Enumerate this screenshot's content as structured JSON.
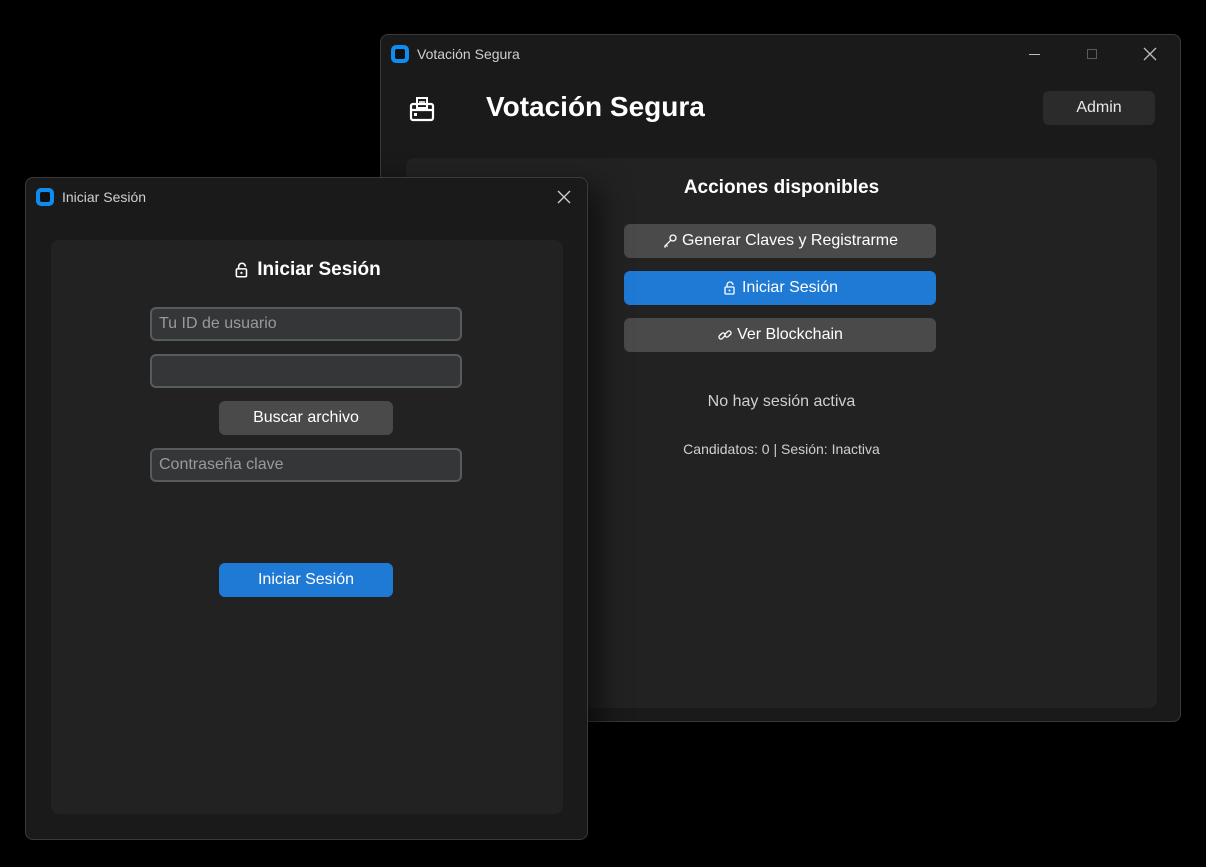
{
  "main_window": {
    "title": "Votación Segura",
    "header_title": "Votación Segura",
    "admin_label": "Admin",
    "panel_title": "Acciones disponibles",
    "actions": {
      "generate_label": "Generar Claves y Registrarme",
      "login_label": "Iniciar Sesión",
      "blockchain_label": "Ver Blockchain"
    },
    "session_status": "No hay sesión activa",
    "info_line": "Candidatos: 0 | Sesión: Inactiva"
  },
  "login_dialog": {
    "title": "Iniciar Sesión",
    "heading": "Iniciar Sesión",
    "user_id_placeholder": "Tu ID de usuario",
    "user_id_value": "",
    "file_value": "",
    "browse_label": "Buscar archivo",
    "password_placeholder": "Contraseña clave",
    "password_value": "",
    "submit_label": "Iniciar Sesión"
  },
  "icons": {
    "app": "app-icon",
    "ballot": "ballot-box-icon",
    "key": "key-icon",
    "lock": "lock-icon",
    "link": "link-icon"
  },
  "colors": {
    "background": "#000000",
    "window": "#1a1a1a",
    "panel": "#222222",
    "button": "#4a4a4a",
    "accent": "#1f7ad6",
    "app_icon": "#0f8cf0"
  }
}
